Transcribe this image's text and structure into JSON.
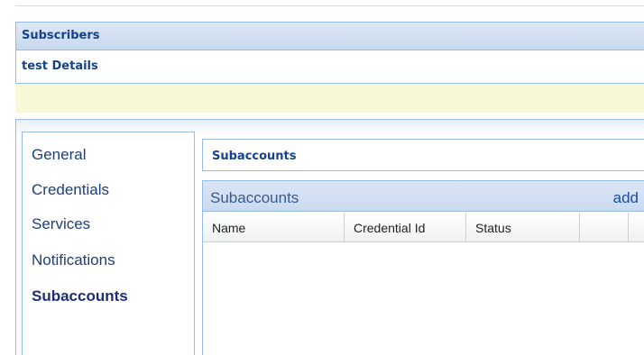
{
  "header": {
    "title": "Subscribers"
  },
  "details": {
    "title": "test Details"
  },
  "nav": {
    "items": [
      {
        "label": "General",
        "active": false
      },
      {
        "label": "Credentials",
        "active": false
      },
      {
        "label": "Services",
        "active": false
      },
      {
        "label": "Notifications",
        "active": false
      },
      {
        "label": "Subaccounts",
        "active": true
      }
    ]
  },
  "section": {
    "title": "Subaccounts"
  },
  "grid": {
    "title": "Subaccounts",
    "add_label": "add",
    "columns": [
      "Name",
      "Credential Id",
      "Status",
      ""
    ],
    "rows": []
  }
}
